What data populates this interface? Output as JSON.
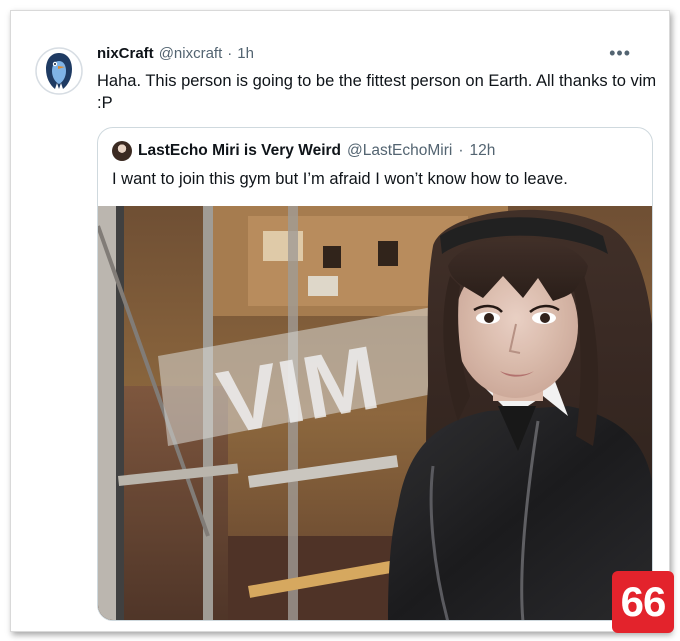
{
  "tweet": {
    "display_name": "nixCraft",
    "handle": "@nixcraft",
    "separator": "·",
    "time": "1h",
    "more_label": "•••",
    "text": "Haha. This person is going to be the fittest person on Earth. All thanks to vim :P",
    "avatar_icon": "penguin-avatar-icon"
  },
  "quote": {
    "display_name": "LastEcho Miri is Very Weird",
    "handle": "@LastEchoMiri",
    "separator": "·",
    "time": "12h",
    "text": "I want to join this gym but I’m afraid I won’t know how to leave.",
    "photo": {
      "door_text": "VIM"
    }
  },
  "watermark": {
    "text": "66"
  },
  "colors": {
    "text_primary": "#0f1419",
    "text_secondary": "#536471",
    "border": "#cfd9de",
    "badge": "#e3232c"
  }
}
